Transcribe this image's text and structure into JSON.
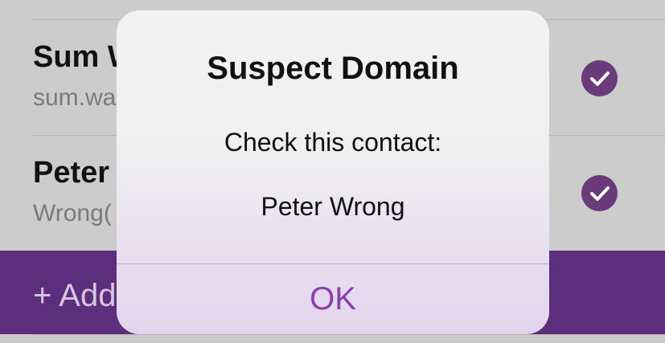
{
  "contacts": [
    {
      "name": "Sum W",
      "email": "sum.wa",
      "checked": true
    },
    {
      "name": "Peter",
      "email": "Wrong(",
      "checked": true
    }
  ],
  "add_button": {
    "label": "+ Add"
  },
  "alert": {
    "title": "Suspect Domain",
    "message": "Check this contact:",
    "contact_name": "Peter Wrong",
    "ok_label": "OK"
  },
  "colors": {
    "accent": "#8a3fae",
    "check_fill": "#6b3a7a",
    "add_bar": "#5d2e7c"
  },
  "icons": {
    "selected": "checkmark-circle-icon"
  }
}
